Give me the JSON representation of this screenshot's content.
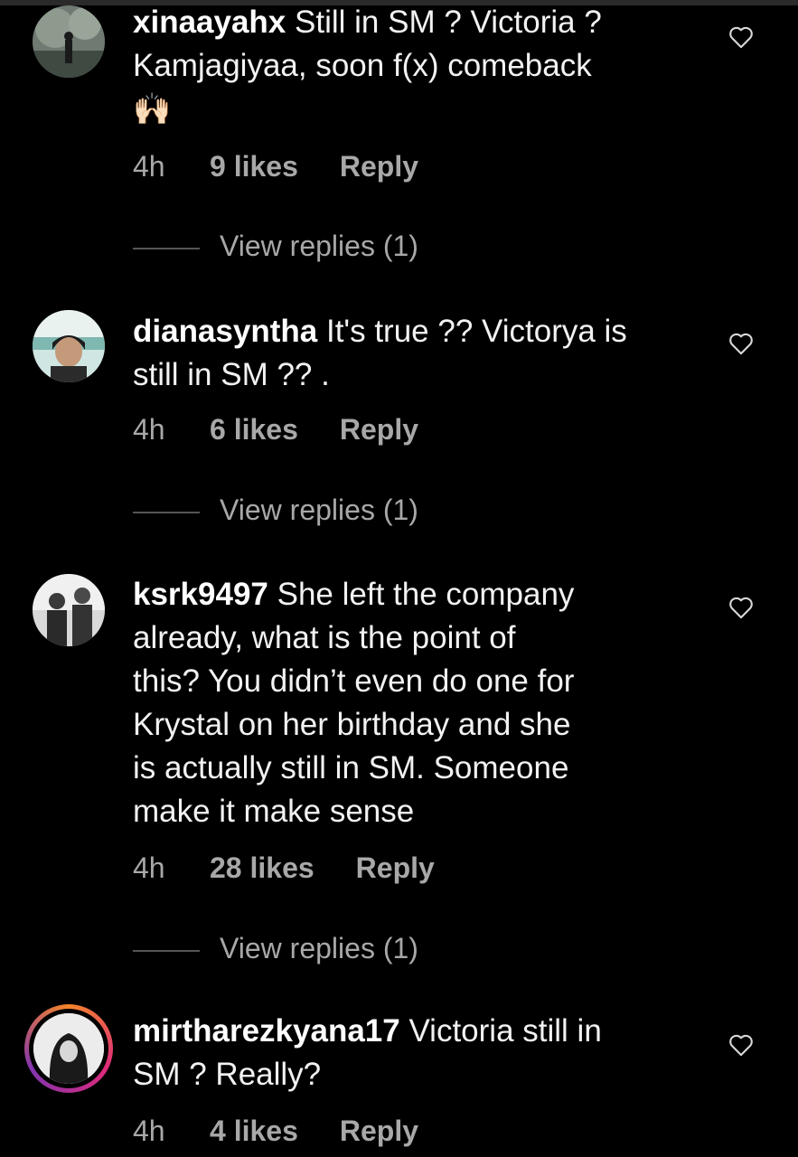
{
  "comments": [
    {
      "username": "xinaayahx",
      "text_lines": [
        "Still in SM ? Victoria ?",
        "Kamjagiyaa, soon f(x) comeback"
      ],
      "emoji": "🙌🏻",
      "time": "4h",
      "likes": "9 likes",
      "reply": "Reply",
      "view_replies": "View replies (1)",
      "avatar": "photo-outdoor-avatar"
    },
    {
      "username": "dianasyntha",
      "text_lines": [
        "It's true ?? Victorya is",
        "still in SM ?? ."
      ],
      "time": "4h",
      "likes": "6 likes",
      "reply": "Reply",
      "view_replies": "View replies (1)",
      "avatar": "photo-selfie-avatar"
    },
    {
      "username": "ksrk9497",
      "text_lines": [
        "She left the company",
        "already, what is the point of",
        "this? You didn’t even do one for",
        "Krystal on her birthday and she",
        "is actually still in SM. Someone",
        "make it make sense"
      ],
      "time": "4h",
      "likes": "28 likes",
      "reply": "Reply",
      "view_replies": "View replies (1)",
      "avatar": "photo-two-people-avatar"
    },
    {
      "username": "mirtharezkyana17",
      "text_lines": [
        "Victoria still in",
        "SM ? Really?"
      ],
      "time": "4h",
      "likes": "4 likes",
      "reply": "Reply",
      "avatar": "photo-hijab-avatar-with-story-ring"
    }
  ],
  "colors": {
    "background": "#000000",
    "text": "#f2f2f2",
    "meta": "#a8a8a8",
    "story_ring": [
      "#f58529",
      "#dd2a7b",
      "#8134af"
    ]
  }
}
